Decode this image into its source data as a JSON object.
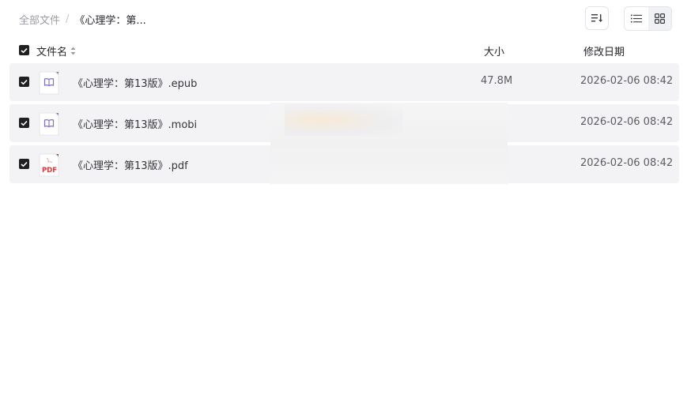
{
  "breadcrumb": {
    "root": "全部文件",
    "separator": "/",
    "current": "《心理学：第..."
  },
  "toolbar": {
    "sort_icon": "sort-icon",
    "view_list_icon": "list-view-icon",
    "view_grid_icon": "grid-view-icon"
  },
  "table": {
    "columns": {
      "name": "文件名",
      "size": "大小",
      "modified": "修改日期"
    },
    "rows": [
      {
        "name": "《心理学：第13版》.epub",
        "size": "47.8M",
        "date": "2026-02-06 08:42",
        "icon": "ebook-icon",
        "checked": true
      },
      {
        "name": "《心理学：第13版》.mobi",
        "size": "",
        "date": "2026-02-06 08:42",
        "icon": "ebook-icon",
        "checked": true
      },
      {
        "name": "《心理学：第13版》.pdf",
        "size": "",
        "date": "2026-02-06 08:42",
        "icon": "pdf-icon",
        "checked": true
      }
    ]
  },
  "colors": {
    "row_bg": "#f3f3f5",
    "ebook_accent": "#7b6fe0",
    "pdf_accent": "#e0383e",
    "checkbox": "#1f1f24"
  }
}
